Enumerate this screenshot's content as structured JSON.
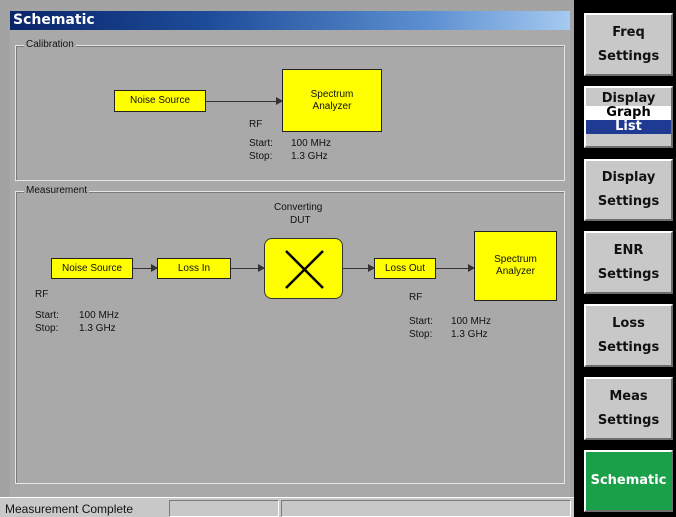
{
  "window": {
    "title": "Schematic"
  },
  "calibration": {
    "label": "Calibration",
    "noise_source": "Noise Source",
    "analyzer_line1": "Spectrum",
    "analyzer_line2": "Analyzer",
    "rf_label": "RF",
    "start_label": "Start:",
    "start_value": "100 MHz",
    "stop_label": "Stop:",
    "stop_value": "1.3 GHz"
  },
  "measurement": {
    "label": "Measurement",
    "dut_line1": "Converting",
    "dut_line2": "DUT",
    "noise_source": "Noise Source",
    "loss_in": "Loss In",
    "loss_out": "Loss Out",
    "analyzer_line1": "Spectrum",
    "analyzer_line2": "Analyzer",
    "left": {
      "rf_label": "RF",
      "start_label": "Start:",
      "start_value": "100 MHz",
      "stop_label": "Stop:",
      "stop_value": "1.3 GHz"
    },
    "right": {
      "rf_label": "RF",
      "start_label": "Start:",
      "start_value": "100 MHz",
      "stop_label": "Stop:",
      "stop_value": "1.3 GHz"
    }
  },
  "status": {
    "text": "Measurement Complete"
  },
  "softkeys": {
    "freq": [
      "Freq",
      "Settings"
    ],
    "display_toggle": {
      "title": "Display",
      "graph": "Graph",
      "list": "List"
    },
    "display": [
      "Display",
      "Settings"
    ],
    "enr": [
      "ENR",
      "Settings"
    ],
    "loss": [
      "Loss",
      "Settings"
    ],
    "meas": [
      "Meas",
      "Settings"
    ],
    "schematic": "Schematic"
  },
  "colors": {
    "component_fill": "#ffff00",
    "active_key": "#19a048",
    "list_highlight": "#1f3a93"
  }
}
